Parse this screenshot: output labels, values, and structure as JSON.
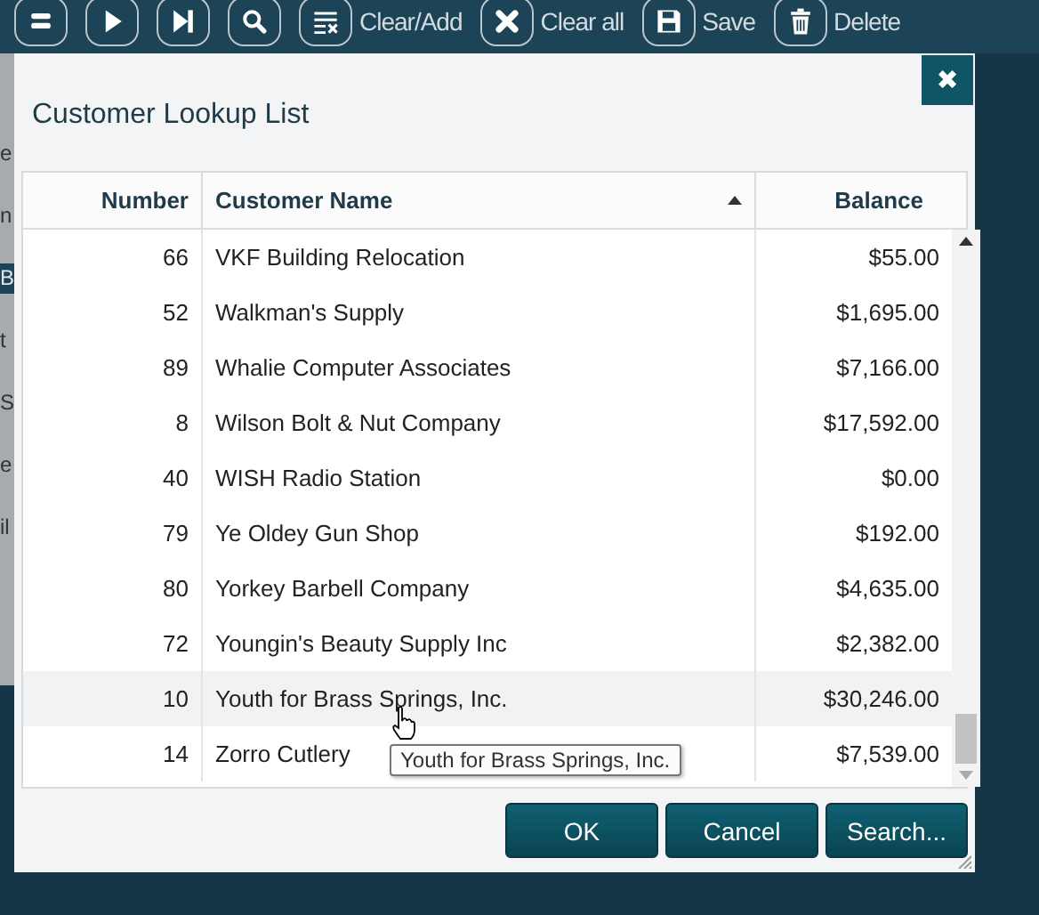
{
  "toolbar_labels": [
    "Clear/Add",
    "Clear all",
    "Save",
    "Delete"
  ],
  "background_fragments": [
    {
      "text": "e",
      "selected": false
    },
    {
      "text": "n",
      "selected": false
    },
    {
      "text": "B",
      "selected": true
    },
    {
      "text": "t",
      "selected": false
    },
    {
      "text": "S",
      "selected": false
    },
    {
      "text": "e",
      "selected": false
    },
    {
      "text": "il",
      "selected": false
    }
  ],
  "dialog": {
    "title": "Customer Lookup List",
    "close": "✖"
  },
  "table": {
    "columns": [
      {
        "label": "Number",
        "sorted": false
      },
      {
        "label": "Customer Name",
        "sorted": true
      },
      {
        "label": "Balance",
        "sorted": false
      }
    ],
    "rows": [
      {
        "number": "66",
        "name": "VKF Building Relocation",
        "balance": "$55.00",
        "highlighted": false
      },
      {
        "number": "52",
        "name": "Walkman's Supply",
        "balance": "$1,695.00",
        "highlighted": false
      },
      {
        "number": "89",
        "name": "Whalie Computer Associates",
        "balance": "$7,166.00",
        "highlighted": false
      },
      {
        "number": "8",
        "name": "Wilson Bolt & Nut Company",
        "balance": "$17,592.00",
        "highlighted": false
      },
      {
        "number": "40",
        "name": "WISH Radio Station",
        "balance": "$0.00",
        "highlighted": false
      },
      {
        "number": "79",
        "name": "Ye Oldey Gun Shop",
        "balance": "$192.00",
        "highlighted": false
      },
      {
        "number": "80",
        "name": "Yorkey Barbell Company",
        "balance": "$4,635.00",
        "highlighted": false
      },
      {
        "number": "72",
        "name": "Youngin's Beauty Supply Inc",
        "balance": "$2,382.00",
        "highlighted": false
      },
      {
        "number": "10",
        "name": "Youth for Brass Springs, Inc.",
        "balance": "$30,246.00",
        "highlighted": true
      },
      {
        "number": "14",
        "name": "Zorro Cutlery",
        "balance": "$7,539.00",
        "highlighted": false
      }
    ]
  },
  "tooltip": "Youth for Brass Springs, Inc.",
  "buttons": [
    "OK",
    "Cancel",
    "Search..."
  ]
}
